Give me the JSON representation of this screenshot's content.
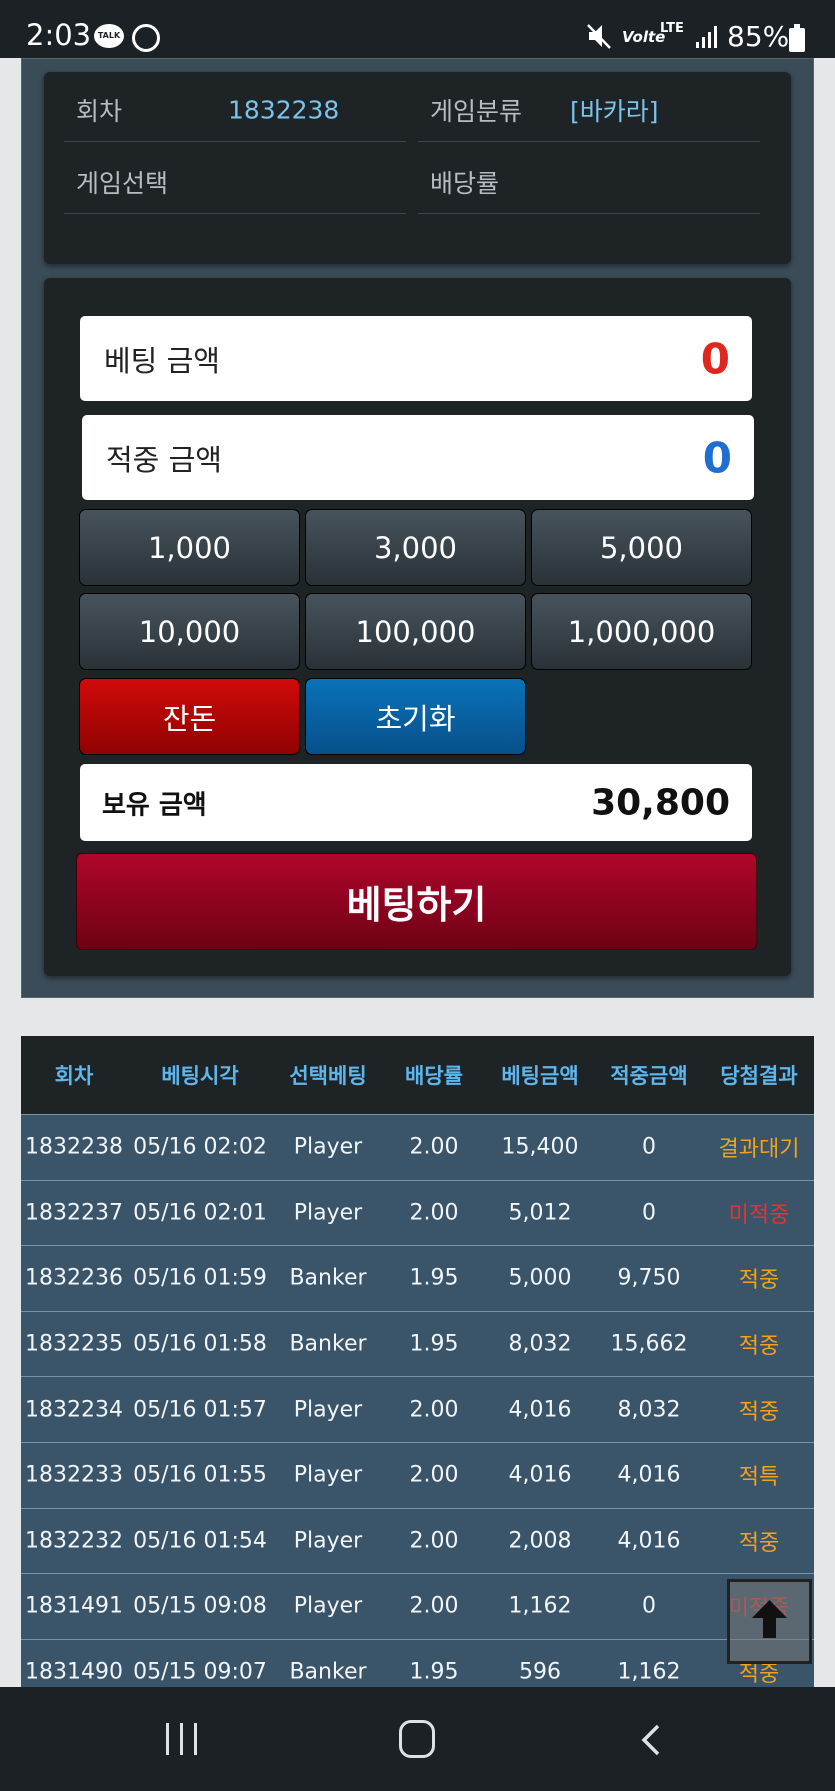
{
  "status_bar": {
    "time": "2:03",
    "talk_icon_text": "TALK",
    "volte": "Volte",
    "lte": "LTE",
    "battery_percent": "85%"
  },
  "round_info": {
    "round_label": "회차",
    "round_value": "1832238",
    "category_label": "게임분류",
    "category_value": "[바카라]",
    "selection_label": "게임선택",
    "selection_value": "",
    "odds_label": "배당률",
    "odds_value": ""
  },
  "bet_panel": {
    "bet_amount_label": "베팅 금액",
    "bet_amount_value": "0",
    "win_amount_label": "적중 금액",
    "win_amount_value": "0",
    "chips": [
      "1,000",
      "3,000",
      "5,000",
      "10,000",
      "100,000",
      "1,000,000"
    ],
    "change_label": "잔돈",
    "reset_label": "초기화",
    "holding_label": "보유 금액",
    "holding_value": "30,800",
    "bet_button_label": "베팅하기"
  },
  "history": {
    "headers": [
      "회차",
      "베팅시각",
      "선택베팅",
      "배당률",
      "베팅금액",
      "적중금액",
      "당첨결과"
    ],
    "rows": [
      {
        "round": "1832238",
        "time": "05/16 02:02",
        "pick": "Player",
        "odds": "2.00",
        "bet": "15,400",
        "win": "0",
        "result": "결과대기",
        "status": "wait"
      },
      {
        "round": "1832237",
        "time": "05/16 02:01",
        "pick": "Player",
        "odds": "2.00",
        "bet": "5,012",
        "win": "0",
        "result": "미적중",
        "status": "miss"
      },
      {
        "round": "1832236",
        "time": "05/16 01:59",
        "pick": "Banker",
        "odds": "1.95",
        "bet": "5,000",
        "win": "9,750",
        "result": "적중",
        "status": "hit"
      },
      {
        "round": "1832235",
        "time": "05/16 01:58",
        "pick": "Banker",
        "odds": "1.95",
        "bet": "8,032",
        "win": "15,662",
        "result": "적중",
        "status": "hit"
      },
      {
        "round": "1832234",
        "time": "05/16 01:57",
        "pick": "Player",
        "odds": "2.00",
        "bet": "4,016",
        "win": "8,032",
        "result": "적중",
        "status": "hit"
      },
      {
        "round": "1832233",
        "time": "05/16 01:55",
        "pick": "Player",
        "odds": "2.00",
        "bet": "4,016",
        "win": "4,016",
        "result": "적특",
        "status": "hit"
      },
      {
        "round": "1832232",
        "time": "05/16 01:54",
        "pick": "Player",
        "odds": "2.00",
        "bet": "2,008",
        "win": "4,016",
        "result": "적중",
        "status": "hit"
      },
      {
        "round": "1831491",
        "time": "05/15 09:08",
        "pick": "Player",
        "odds": "2.00",
        "bet": "1,162",
        "win": "0",
        "result": "미적중",
        "status": "miss"
      },
      {
        "round": "1831490",
        "time": "05/15 09:07",
        "pick": "Banker",
        "odds": "1.95",
        "bet": "596",
        "win": "1,162",
        "result": "적중",
        "status": "hit"
      }
    ]
  },
  "colors": {
    "accent_blue": "#5eb6ee",
    "bet_red": "#e0261f",
    "win_blue": "#1e6fd0",
    "result_orange": "#f2a21b",
    "result_red": "#e8332b"
  },
  "icons": {
    "scroll_top": "arrow-up-icon"
  }
}
